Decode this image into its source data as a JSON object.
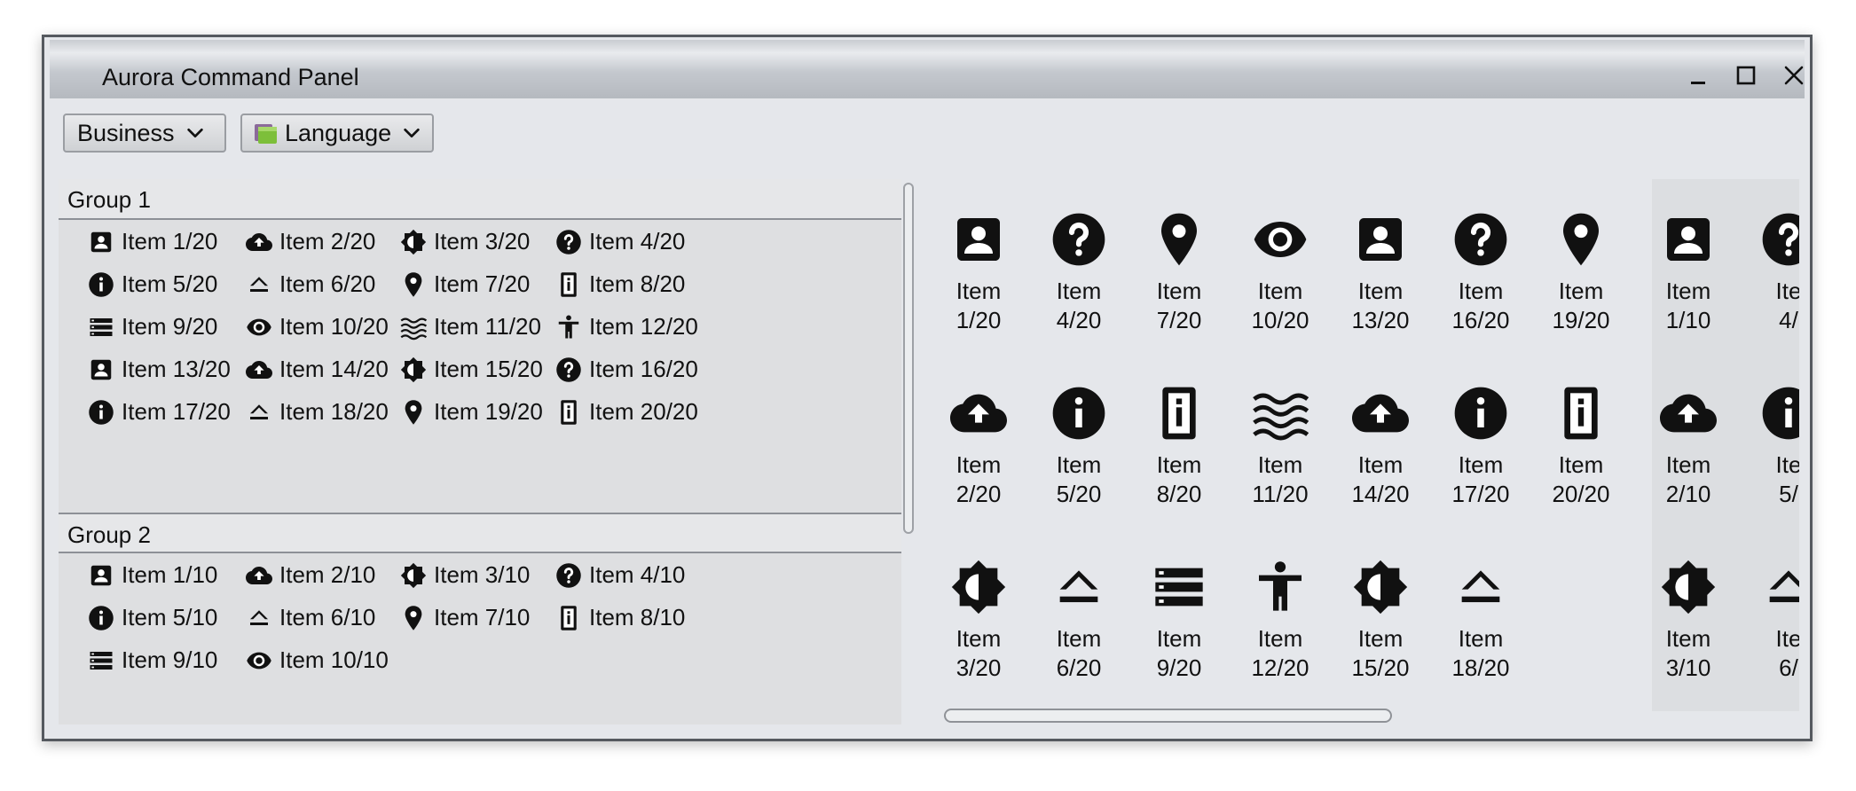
{
  "window": {
    "title": "Aurora Command Panel"
  },
  "toolbar": {
    "business_label": "Business",
    "language_label": "Language"
  },
  "groups": [
    {
      "header": "Group 1",
      "items": [
        {
          "label": "Item 1/20",
          "icon": "contact-card-icon"
        },
        {
          "label": "Item 2/20",
          "icon": "cloud-upload-icon"
        },
        {
          "label": "Item 3/20",
          "icon": "brightness-icon"
        },
        {
          "label": "Item 4/20",
          "icon": "help-circle-icon"
        },
        {
          "label": "Item 5/20",
          "icon": "info-circle-icon"
        },
        {
          "label": "Item 6/20",
          "icon": "eject-icon"
        },
        {
          "label": "Item 7/20",
          "icon": "location-pin-icon"
        },
        {
          "label": "Item 8/20",
          "icon": "info-device-icon"
        },
        {
          "label": "Item 9/20",
          "icon": "storage-list-icon"
        },
        {
          "label": "Item 10/20",
          "icon": "eye-icon"
        },
        {
          "label": "Item 11/20",
          "icon": "waves-icon"
        },
        {
          "label": "Item 12/20",
          "icon": "accessibility-icon"
        },
        {
          "label": "Item 13/20",
          "icon": "contact-card-icon"
        },
        {
          "label": "Item 14/20",
          "icon": "cloud-upload-icon"
        },
        {
          "label": "Item 15/20",
          "icon": "brightness-icon"
        },
        {
          "label": "Item 16/20",
          "icon": "help-circle-icon"
        },
        {
          "label": "Item 17/20",
          "icon": "info-circle-icon"
        },
        {
          "label": "Item 18/20",
          "icon": "eject-icon"
        },
        {
          "label": "Item 19/20",
          "icon": "location-pin-icon"
        },
        {
          "label": "Item 20/20",
          "icon": "info-device-icon"
        }
      ]
    },
    {
      "header": "Group 2",
      "items": [
        {
          "label": "Item 1/10",
          "icon": "contact-card-icon"
        },
        {
          "label": "Item 2/10",
          "icon": "cloud-upload-icon"
        },
        {
          "label": "Item 3/10",
          "icon": "brightness-icon"
        },
        {
          "label": "Item 4/10",
          "icon": "help-circle-icon"
        },
        {
          "label": "Item 5/10",
          "icon": "info-circle-icon"
        },
        {
          "label": "Item 6/10",
          "icon": "eject-icon"
        },
        {
          "label": "Item 7/10",
          "icon": "location-pin-icon"
        },
        {
          "label": "Item 8/10",
          "icon": "info-device-icon"
        },
        {
          "label": "Item 9/10",
          "icon": "storage-list-icon"
        },
        {
          "label": "Item 10/10",
          "icon": "eye-icon"
        }
      ]
    }
  ],
  "tiles_group1": [
    {
      "line1": "Item",
      "line2": "1/20",
      "icon": "contact-card-icon"
    },
    {
      "line1": "Item",
      "line2": "4/20",
      "icon": "help-circle-icon"
    },
    {
      "line1": "Item",
      "line2": "7/20",
      "icon": "location-pin-icon"
    },
    {
      "line1": "Item",
      "line2": "10/20",
      "icon": "eye-icon"
    },
    {
      "line1": "Item",
      "line2": "13/20",
      "icon": "contact-card-icon"
    },
    {
      "line1": "Item",
      "line2": "16/20",
      "icon": "help-circle-icon"
    },
    {
      "line1": "Item",
      "line2": "19/20",
      "icon": "location-pin-icon"
    },
    {
      "line1": "Item",
      "line2": "2/20",
      "icon": "cloud-upload-icon"
    },
    {
      "line1": "Item",
      "line2": "5/20",
      "icon": "info-circle-icon"
    },
    {
      "line1": "Item",
      "line2": "8/20",
      "icon": "info-device-icon"
    },
    {
      "line1": "Item",
      "line2": "11/20",
      "icon": "waves-icon"
    },
    {
      "line1": "Item",
      "line2": "14/20",
      "icon": "cloud-upload-icon"
    },
    {
      "line1": "Item",
      "line2": "17/20",
      "icon": "info-circle-icon"
    },
    {
      "line1": "Item",
      "line2": "20/20",
      "icon": "info-device-icon"
    },
    {
      "line1": "Item",
      "line2": "3/20",
      "icon": "brightness-icon"
    },
    {
      "line1": "Item",
      "line2": "6/20",
      "icon": "eject-icon"
    },
    {
      "line1": "Item",
      "line2": "9/20",
      "icon": "storage-list-icon"
    },
    {
      "line1": "Item",
      "line2": "12/20",
      "icon": "accessibility-icon"
    },
    {
      "line1": "Item",
      "line2": "15/20",
      "icon": "brightness-icon"
    },
    {
      "line1": "Item",
      "line2": "18/20",
      "icon": "eject-icon"
    }
  ],
  "tiles_group2": [
    {
      "line1": "Item",
      "line2": "1/10",
      "icon": "contact-card-icon"
    },
    {
      "line1": "Ite",
      "line2": "4/",
      "icon": "help-circle-icon"
    },
    {
      "line1": "Item",
      "line2": "2/10",
      "icon": "cloud-upload-icon"
    },
    {
      "line1": "Ite",
      "line2": "5/",
      "icon": "info-circle-icon"
    },
    {
      "line1": "Item",
      "line2": "3/10",
      "icon": "brightness-icon"
    },
    {
      "line1": "Ite",
      "line2": "6/",
      "icon": "eject-icon"
    }
  ]
}
